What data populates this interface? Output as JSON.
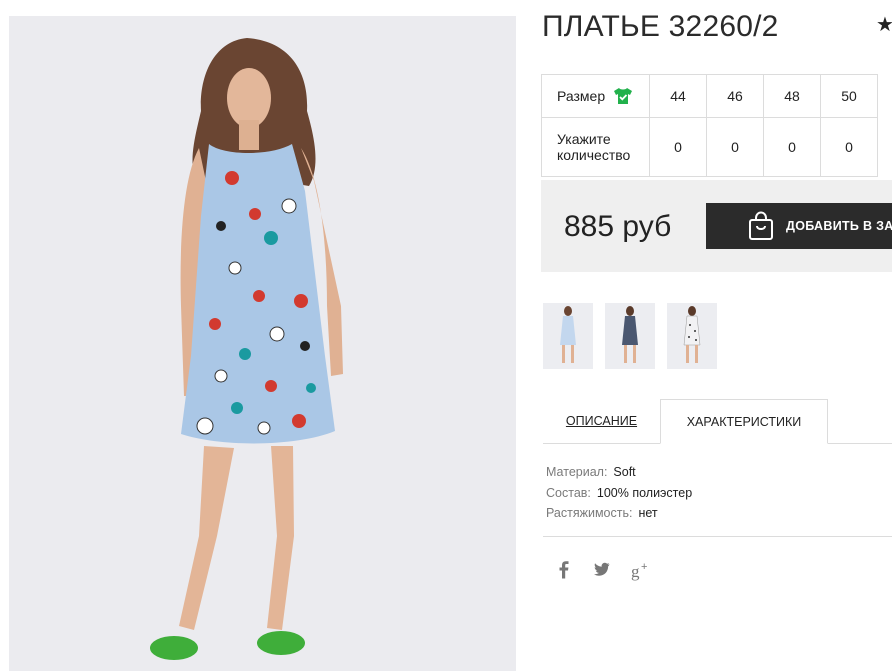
{
  "product": {
    "title": "ПЛАТЬЕ 32260/2",
    "favorite_icon": "star-icon",
    "main_photo": "product-photo"
  },
  "size_table": {
    "size_label": "Размер",
    "size_chart_icon": "tshirt-icon",
    "sizes": [
      "44",
      "46",
      "48",
      "50"
    ],
    "quantity_label": "Укажите количество",
    "quantities": [
      "0",
      "0",
      "0",
      "0"
    ]
  },
  "purchase": {
    "price": "885 руб",
    "add_to_cart_label": "ДОБАВИТЬ В ЗАК",
    "cart_icon": "shopping-bag-icon",
    "button_color": "#2b2b2b"
  },
  "thumbnails": [
    "product-thumb-1",
    "product-thumb-2",
    "product-thumb-3"
  ],
  "tabs": {
    "description": "ОПИСАНИЕ",
    "characteristics": "ХАРАКТЕРИСТИКИ",
    "active": "characteristics"
  },
  "specs": [
    {
      "key": "Материал:",
      "value": "Soft"
    },
    {
      "key": "Состав:",
      "value": "100% полиэстер"
    },
    {
      "key": "Растяжимость:",
      "value": "нет"
    }
  ],
  "social": [
    "facebook-icon",
    "twitter-icon",
    "google-plus-icon"
  ],
  "colors": {
    "accent_green": "#22b14c",
    "price_box_bg": "#efefef",
    "photo_bg": "#ebebef",
    "dress_blue": "#aac7e6"
  }
}
